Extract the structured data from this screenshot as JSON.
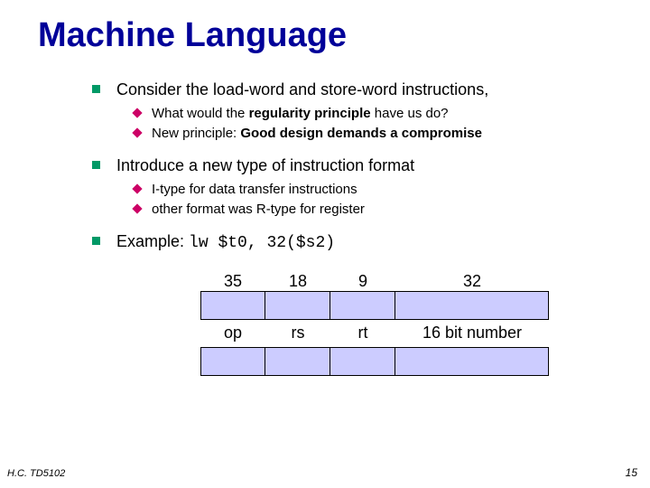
{
  "title": "Machine Language",
  "bullets": [
    {
      "text": "Consider the load-word and store-word instructions,",
      "sub": [
        {
          "prefix": "What would the ",
          "em": "regularity principle",
          "suffix": " have us do?"
        },
        {
          "prefix": "New principle:  ",
          "em": "Good design demands a compromise",
          "suffix": ""
        }
      ]
    },
    {
      "text": "Introduce a new type of instruction format",
      "sub": [
        {
          "prefix": "I-type for data transfer instructions",
          "em": "",
          "suffix": ""
        },
        {
          "prefix": "other format was R-type for register",
          "em": "",
          "suffix": ""
        }
      ]
    }
  ],
  "example": {
    "label": "Example:  ",
    "code": "lw $t0, 32($s2)"
  },
  "table": {
    "values": [
      "35",
      "18",
      "9",
      "32"
    ],
    "labels": [
      "op",
      "rs",
      "rt",
      "16 bit number"
    ]
  },
  "footer": {
    "left": "H.C.  TD5102",
    "right": "15"
  }
}
